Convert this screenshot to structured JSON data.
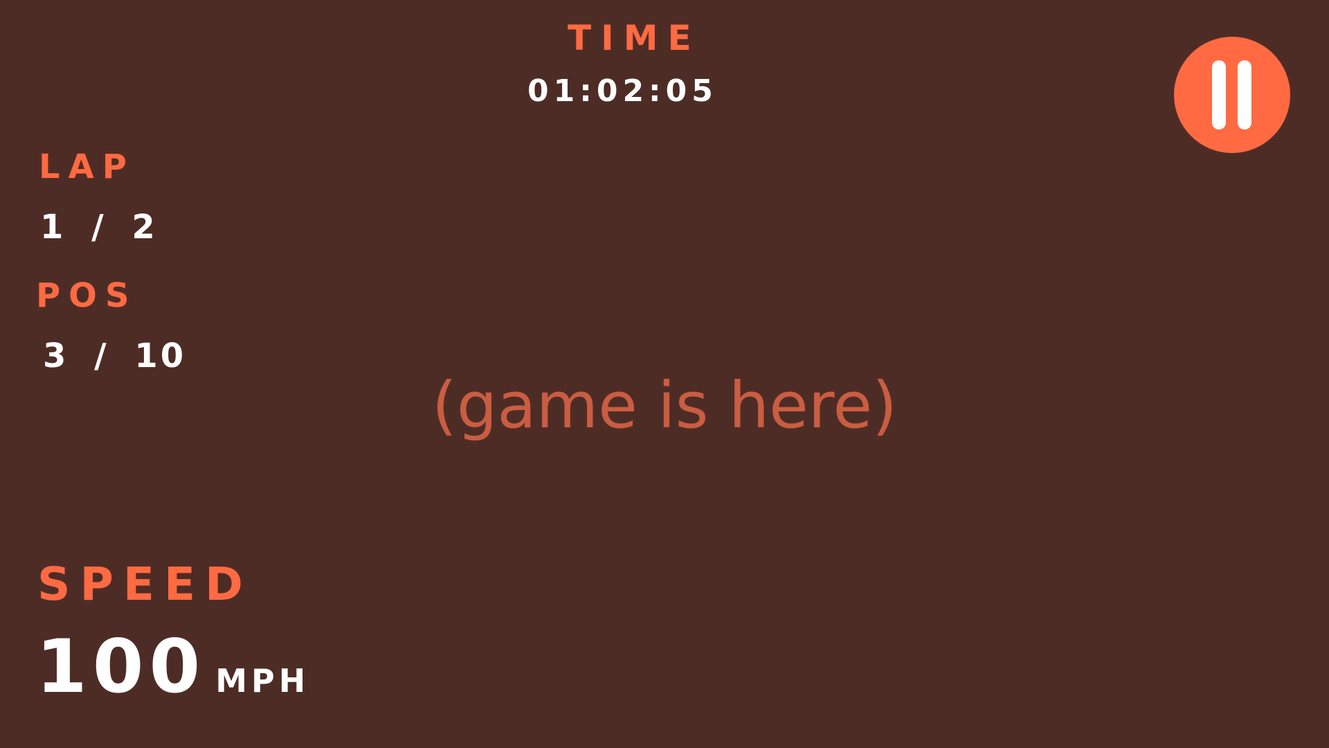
{
  "hud": {
    "time": {
      "label": "TIME",
      "value": "01:02:05"
    },
    "lap": {
      "label": "LAP",
      "value": "1 / 2",
      "current": 1,
      "total": 2
    },
    "position": {
      "label": "POS",
      "value": "3 / 10",
      "current": 3,
      "total": 10
    },
    "speed": {
      "label": "SPEED",
      "value": "100",
      "unit": "MPH"
    }
  },
  "game_area": {
    "placeholder": "(game is here)"
  },
  "controls": {
    "pause_icon": "pause-icon"
  },
  "colors": {
    "background": "#4e2c26",
    "accent": "#ff6a42",
    "text": "#ffffff",
    "placeholder": "#c95d42"
  }
}
